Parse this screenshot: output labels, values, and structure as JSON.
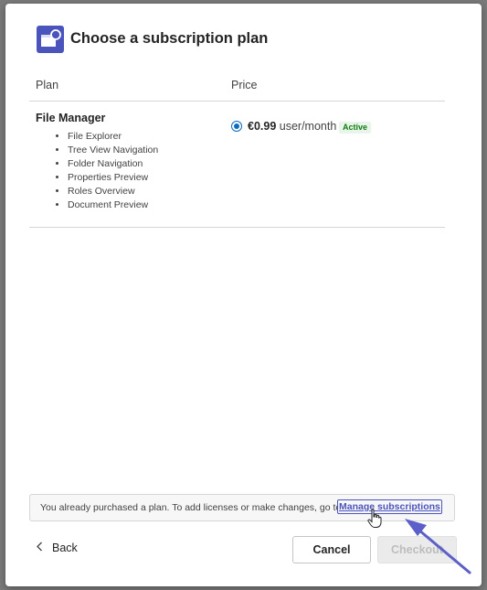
{
  "dialog": {
    "title": "Choose a subscription plan",
    "app_icon": "app-window-icon",
    "columns": {
      "plan": "Plan",
      "price": "Price"
    }
  },
  "plan": {
    "name": "File Manager",
    "features": [
      "File Explorer",
      "Tree View Navigation",
      "Folder Navigation",
      "Properties Preview",
      "Roles Overview",
      "Document Preview"
    ],
    "price_amount": "€0.99",
    "price_unit": "user/month",
    "status_badge": "Active",
    "selected": true
  },
  "info_bar": {
    "text": "You already purchased a plan. To add licenses or make changes, go to",
    "link": "Manage subscriptions"
  },
  "footer": {
    "back": "Back",
    "cancel": "Cancel",
    "checkout": "Checkout"
  },
  "colors": {
    "accent": "#4b53bc",
    "radio": "#0f6cbd",
    "badge_bg": "#e9f5ea",
    "badge_text": "#107c10",
    "annotation_arrow": "#5b5fc7"
  }
}
